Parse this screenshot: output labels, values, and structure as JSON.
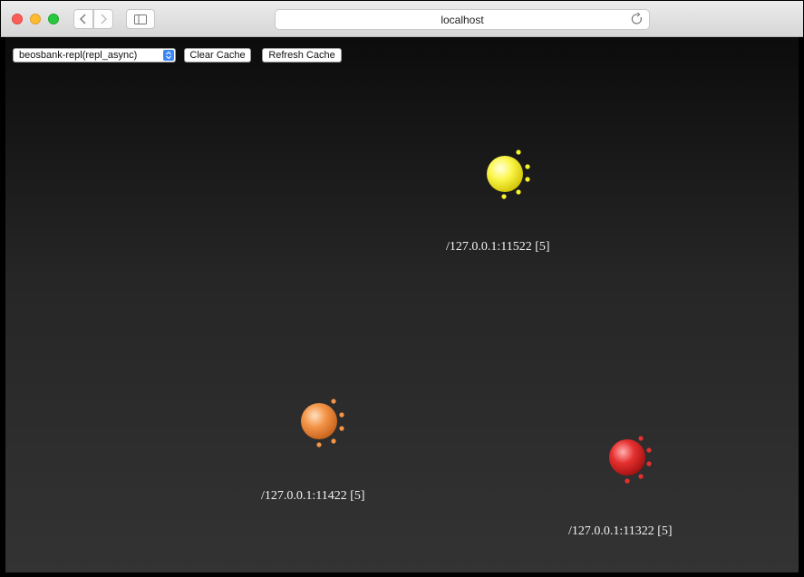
{
  "browser": {
    "url": "localhost",
    "icons": [
      "back-icon",
      "forward-icon",
      "sidebar-icon",
      "reload-icon"
    ]
  },
  "toolbar": {
    "selected_option": "beosbank-repl(repl_async)",
    "clear_label": "Clear Cache",
    "refresh_label": "Refresh Cache"
  },
  "nodes": [
    {
      "label": "/127.0.0.1:11522 [5]",
      "color": "#f7f52a"
    },
    {
      "label": "/127.0.0.1:11422 [5]",
      "color": "#f39447"
    },
    {
      "label": "/127.0.0.1:11322 [5]",
      "color": "#e5302f"
    }
  ]
}
